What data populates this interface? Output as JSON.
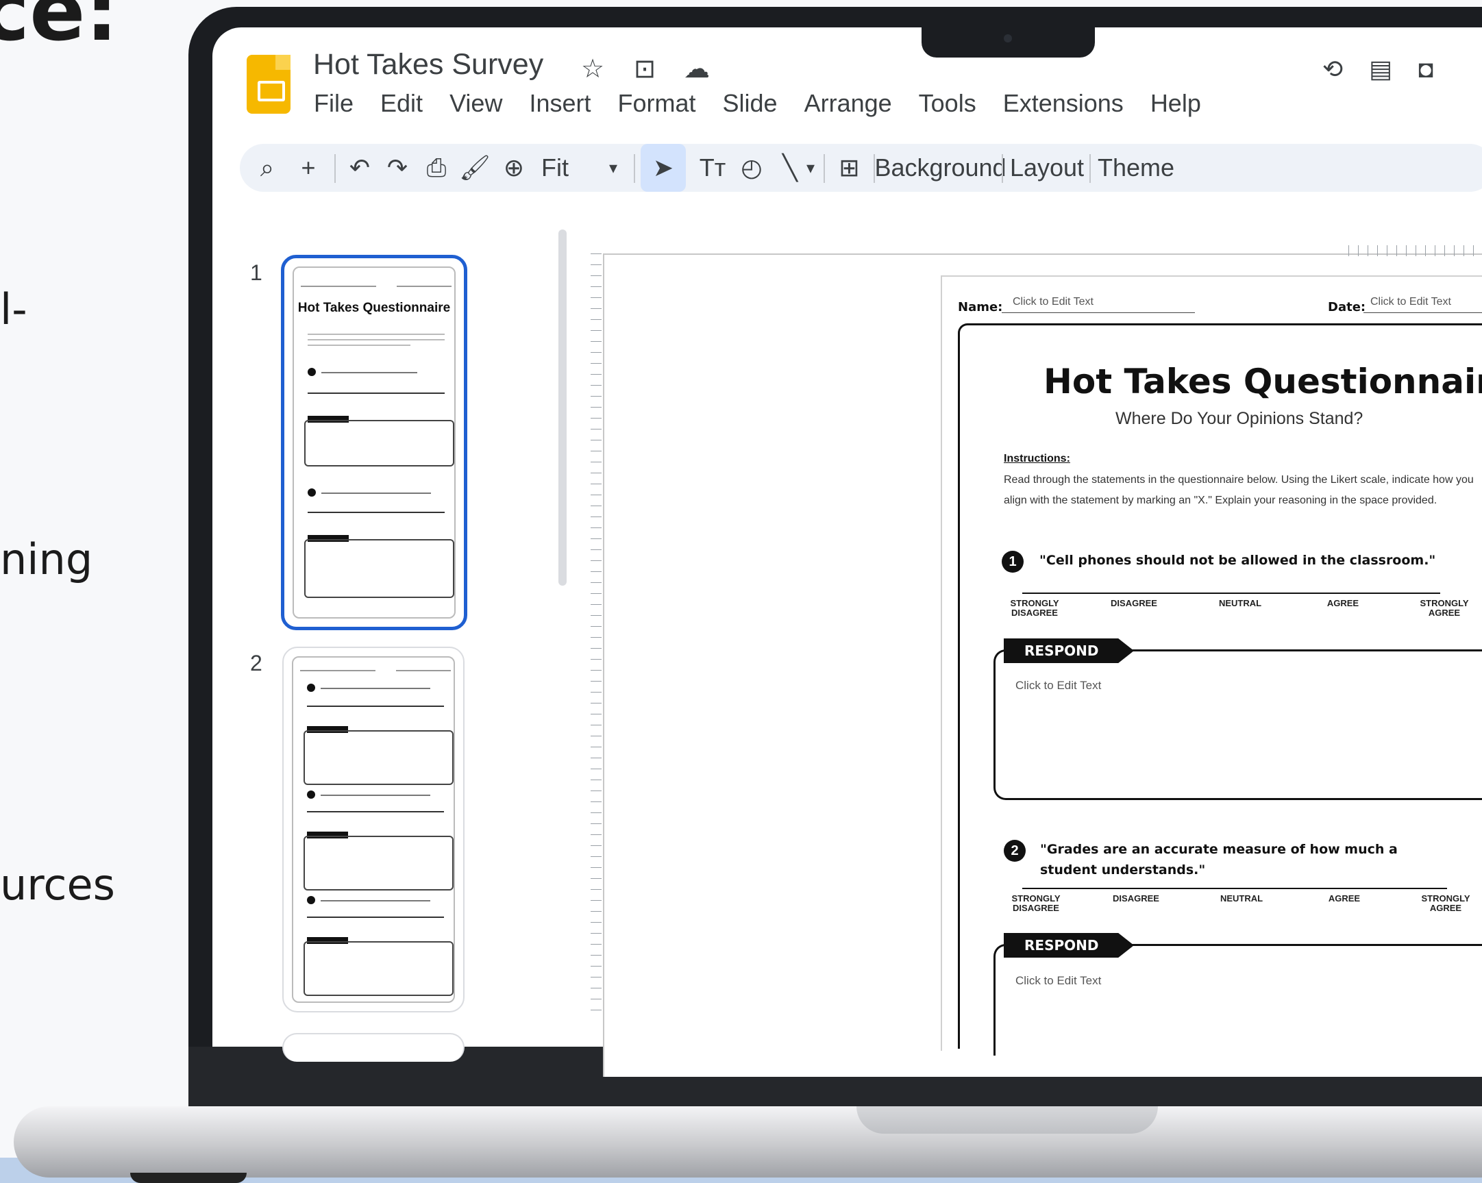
{
  "left_fragments": {
    "heading": "ce:",
    "line1": "l-",
    "line2": "ning",
    "line3": "urces"
  },
  "app": {
    "doc_title": "Hot Takes Survey",
    "menu": [
      "File",
      "Edit",
      "View",
      "Insert",
      "Format",
      "Slide",
      "Arrange",
      "Tools",
      "Extensions",
      "Help"
    ],
    "title_icons": [
      "star-icon",
      "move-to-folder-icon",
      "cloud-saved-icon"
    ],
    "right_icons": [
      "version-history-icon",
      "comments-icon",
      "camera-icon"
    ]
  },
  "toolbar": {
    "zoom_label": "Fit",
    "background_label": "Background",
    "layout_label": "Layout",
    "theme_label": "Theme",
    "text_style_glyph": "Tт"
  },
  "filmstrip": {
    "slides": [
      {
        "number": "1",
        "title": "Hot Takes Questionnaire"
      },
      {
        "number": "2",
        "title": ""
      }
    ]
  },
  "slide": {
    "name_label": "Name:",
    "date_label": "Date:",
    "name_hint": "Click to Edit Text",
    "date_hint": "Click to Edit Text",
    "title": "Hot Takes Questionnaire",
    "subtitle": "Where Do Your Opinions Stand?",
    "instructions_heading": "Instructions:",
    "instructions": "Read through the statements in the questionnaire below. Using the Likert scale, indicate how you align with the statement by marking an \"X.\" Explain your reasoning in the space provided.",
    "scale": [
      "STRONGLY DISAGREE",
      "DISAGREE",
      "NEUTRAL",
      "AGREE",
      "STRONGLY AGREE"
    ],
    "respond_label": "RESPOND",
    "response_hint": "Click to Edit Text",
    "questions": [
      {
        "number": "1",
        "text": "\"Cell phones should not be allowed in the classroom.\""
      },
      {
        "number": "2",
        "text": "\"Grades are an accurate measure of how much a student understands.\""
      }
    ]
  }
}
